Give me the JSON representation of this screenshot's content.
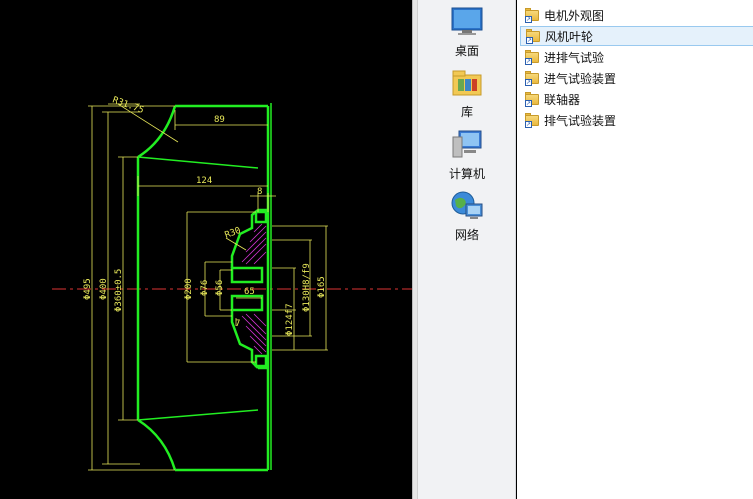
{
  "cad": {
    "dims": {
      "r_top": "R31.75",
      "d89": "89",
      "d124": "124",
      "d8": "8",
      "r30": "R30",
      "phi200": "Φ200",
      "phi76": "Φ76",
      "phi56": "Φ56",
      "d65": "65",
      "d7": "7",
      "phi495": "Φ495",
      "phi400": "Φ400",
      "phi360": "Φ360±0.5",
      "phi130": "Φ130H8/f9",
      "phi165": "Φ165",
      "phi1247": "Φ124f7"
    }
  },
  "nav": {
    "items": [
      {
        "label": "桌面",
        "icon": "desktop-icon"
      },
      {
        "label": "库",
        "icon": "library-icon"
      },
      {
        "label": "计算机",
        "icon": "computer-icon"
      },
      {
        "label": "网络",
        "icon": "network-icon"
      }
    ]
  },
  "files": [
    {
      "name": "电机外观图",
      "selected": false
    },
    {
      "name": "风机叶轮",
      "selected": true
    },
    {
      "name": "进排气试验",
      "selected": false
    },
    {
      "name": "进气试验装置",
      "selected": false
    },
    {
      "name": "联轴器",
      "selected": false
    },
    {
      "name": "排气试验装置",
      "selected": false
    }
  ],
  "colors": {
    "outline": "#22ee22",
    "dimension": "#e8e85a",
    "centerline": "#dd3333",
    "hatch": "#cc33cc",
    "selection": "#e5f1fb"
  }
}
